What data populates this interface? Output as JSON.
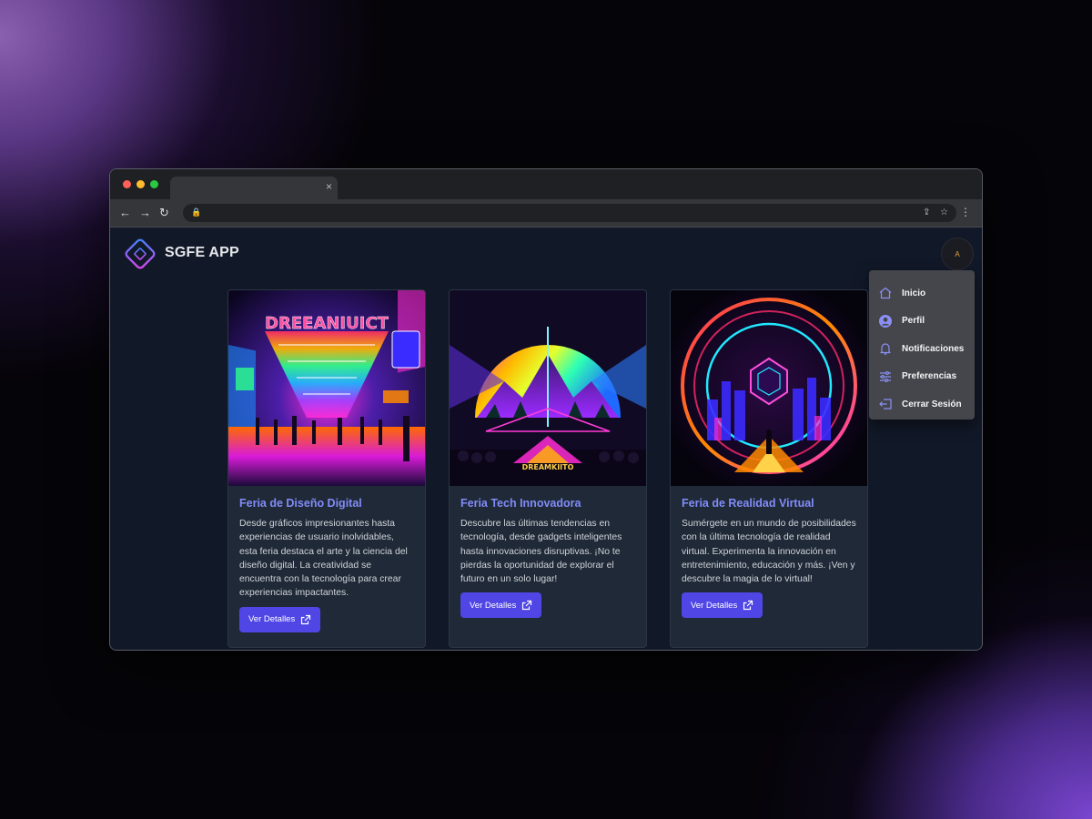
{
  "browser": {
    "tab_close": "×"
  },
  "app": {
    "title": "SGFE APP",
    "avatar_initial": "A"
  },
  "dropdown": {
    "items": [
      {
        "label": "Inicio",
        "icon": "home-icon"
      },
      {
        "label": "Perfil",
        "icon": "user-circle-icon"
      },
      {
        "label": "Notificaciones",
        "icon": "bell-icon"
      },
      {
        "label": "Preferencias",
        "icon": "sliders-icon"
      },
      {
        "label": "Cerrar Sesión",
        "icon": "logout-icon"
      }
    ]
  },
  "cards": [
    {
      "title": "Feria de Diseño Digital",
      "description": "Desde gráficos impresionantes hasta experiencias de usuario inolvidables, esta feria destaca el arte y la ciencia del diseño digital. La creatividad se encuentra con la tecnología para crear experiencias impactantes.",
      "button": "Ver Detalles",
      "image_text": "DREEANIUICT"
    },
    {
      "title": "Feria Tech Innovadora",
      "description": "Descubre las últimas tendencias en tecnología, desde gadgets inteligentes hasta innovaciones disruptivas. ¡No te pierdas la oportunidad de explorar el futuro en un solo lugar!",
      "button": "Ver Detalles",
      "image_text": "DREAMKIITO"
    },
    {
      "title": "Feria de Realidad Virtual",
      "description": "Sumérgete en un mundo de posibilidades con la última tecnología de realidad virtual. Experimenta la innovación en entretenimiento, educación y más. ¡Ven y descubre la magia de lo virtual!",
      "button": "Ver Detalles"
    }
  ],
  "colors": {
    "accent": "#4f46e5",
    "title": "#818cf8",
    "card_bg": "#1f2937",
    "page_bg": "#111827"
  }
}
